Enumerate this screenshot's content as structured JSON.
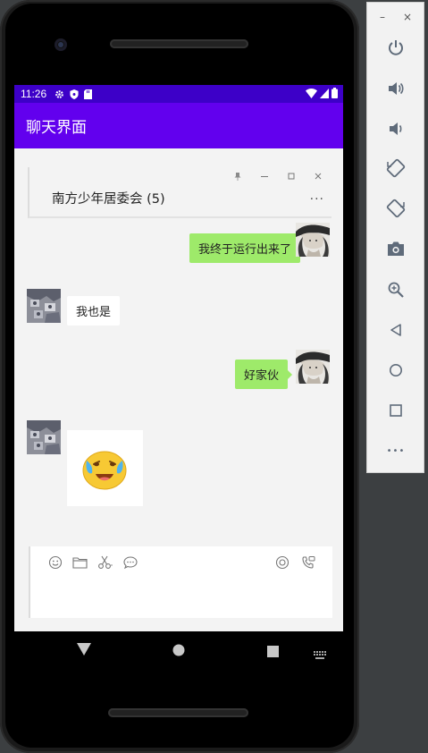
{
  "status_bar": {
    "time": "11:26",
    "left_icons": [
      "gear-icon",
      "shield-icon",
      "sd-card-icon"
    ],
    "right_icons": [
      "wifi-icon",
      "signal-icon",
      "battery-icon"
    ]
  },
  "app_bar": {
    "title": "聊天界面"
  },
  "chat_window": {
    "title": "南方少年居委会 (5)",
    "controls": [
      "pin-icon",
      "minimize-icon",
      "maximize-icon",
      "close-icon"
    ],
    "more": "···"
  },
  "messages": [
    {
      "side": "right",
      "type": "text",
      "text": "我终于运行出来了"
    },
    {
      "side": "left",
      "type": "text",
      "text": "我也是"
    },
    {
      "side": "right",
      "type": "text",
      "text": "好家伙"
    },
    {
      "side": "left",
      "type": "sticker",
      "sticker": "laughing-crying-emoji"
    }
  ],
  "input": {
    "toolbar_left": [
      "emoji-icon",
      "folder-icon",
      "scissors-icon",
      "chat-bubble-icon"
    ],
    "toolbar_right": [
      "voice-record-icon",
      "phone-call-icon"
    ],
    "value": "",
    "placeholder": ""
  },
  "nav_bar": [
    "back-button",
    "home-button",
    "recents-button"
  ],
  "emulator_panel": {
    "window_controls": {
      "minimize": "–",
      "close": "×"
    },
    "buttons": [
      "power",
      "volume-up",
      "volume-down",
      "rotate-left",
      "rotate-right",
      "camera",
      "zoom",
      "back",
      "home",
      "overview",
      "more"
    ],
    "more_label": "•••"
  },
  "colors": {
    "status_bar": "#3d00c8",
    "app_bar": "#6200ee",
    "sent_bubble": "#9eea6a",
    "received_bubble": "#ffffff",
    "chat_background": "#f3f3f3"
  }
}
